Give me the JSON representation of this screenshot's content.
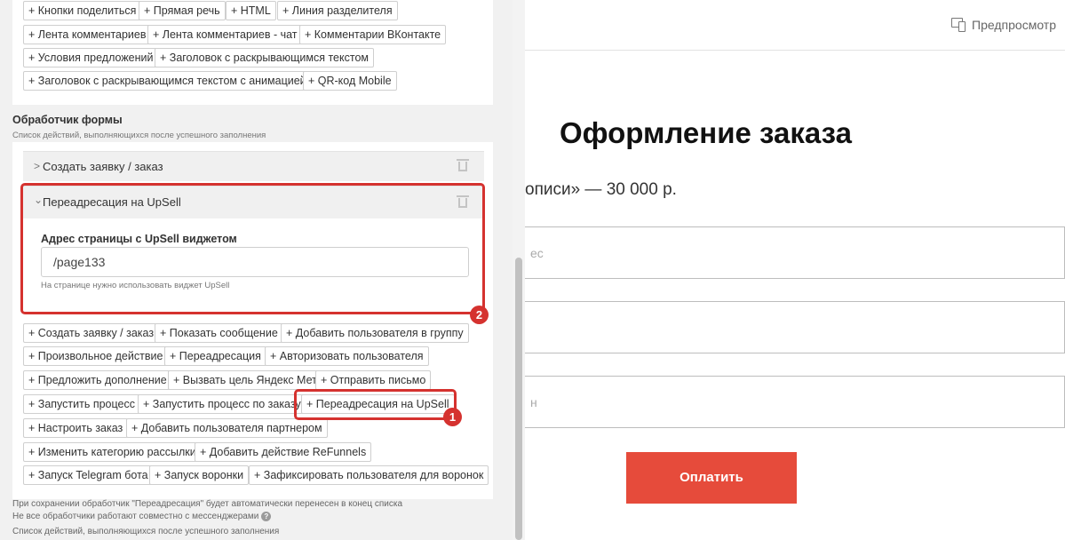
{
  "widget_buttons": [
    "+ Кнопки поделиться",
    "+ Прямая речь",
    "+ HTML",
    "+ Линия разделителя",
    "+ Лента комментариев",
    "+ Лента комментариев - чат",
    "+ Комментарии ВКонтакте",
    "+ Условия предложений",
    "+ Заголовок с раскрывающимся текстом",
    "+ Заголовок с раскрывающимся текстом с анимацией",
    "+ QR-код Mobile"
  ],
  "form_handler": {
    "title": "Обработчик формы",
    "subtitle": "Список действий, выполняющихся после успешного заполнения",
    "actions": [
      {
        "label": "Создать заявку / заказ",
        "chevron": ">"
      },
      {
        "label": "Переадресация на UpSell",
        "chevron": "⌄"
      }
    ],
    "upsell_field": {
      "label": "Адрес страницы с UpSell виджетом",
      "value": "/page133",
      "hint": "На странице нужно использовать виджет UpSell"
    }
  },
  "add_action_buttons": [
    "+ Создать заявку / заказ",
    "+ Показать сообщение",
    "+ Добавить пользователя в группу",
    "+ Произвольное действие",
    "+ Переадресация",
    "+ Авторизовать пользователя",
    "+ Предложить дополнение",
    "+ Вызвать цель Яндекс Метрики",
    "+ Отправить письмо",
    "+ Запустить процесс",
    "+ Запустить процесс по заказу",
    "+ Переадресация на UpSell",
    "+ Настроить заказ",
    "+ Добавить пользователя партнером",
    "+ Изменить категорию рассылки",
    "+ Добавить действие ReFunnels",
    "+ Запуск Telegram бота",
    "+ Запуск воронки",
    "+ Зафиксировать пользователя для воронок"
  ],
  "notes": {
    "line1": "При сохранении обработчик \"Переадресация\" будет автоматически перенесен в конец списка",
    "line2": "Не все обработчики работают совместно с мессенджерами",
    "help_glyph": "?",
    "line3": "Список действий, выполняющихся после успешного заполнения"
  },
  "annotations": {
    "badge1": "1",
    "badge2": "2",
    "highlight_color": "#d5322f"
  },
  "preview_panel": {
    "preview_label": "Предпросмотр",
    "heading": "Оформление заказа",
    "subtitle": "описи» — 30 000 р.",
    "field_fragments": [
      "ес",
      "",
      "н"
    ],
    "pay_button": "Оплатить",
    "pay_color": "#e64b3b"
  }
}
